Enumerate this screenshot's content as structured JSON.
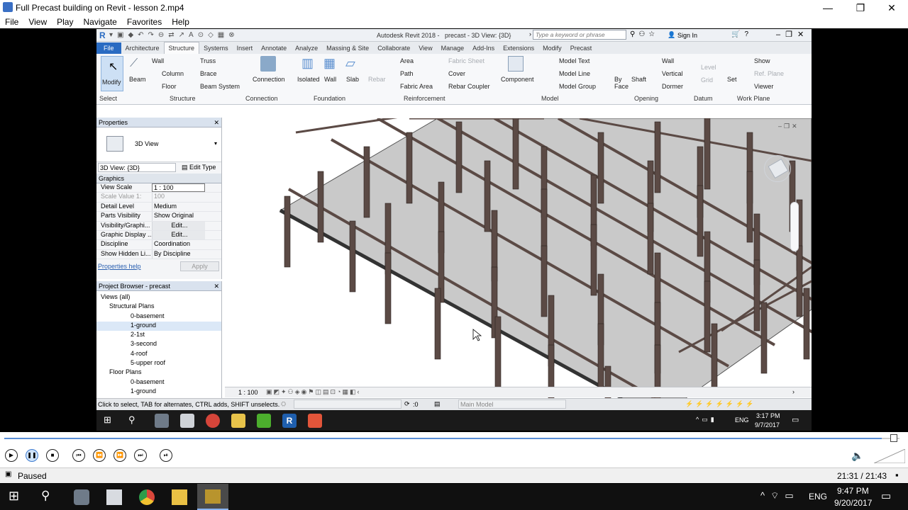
{
  "player": {
    "title": "Full Precast building on Revit - lesson 2.mp4",
    "menu": [
      "File",
      "View",
      "Play",
      "Navigate",
      "Favorites",
      "Help"
    ],
    "status": "Paused",
    "time": "21:31 / 21:43"
  },
  "revit": {
    "app_title": "Autodesk Revit 2018 -",
    "doc_title": "precast - 3D View: {3D}",
    "search_placeholder": "Type a keyword or phrase",
    "sign_in": "Sign In",
    "tabs": [
      "File",
      "Architecture",
      "Structure",
      "Systems",
      "Insert",
      "Annotate",
      "Analyze",
      "Massing & Site",
      "Collaborate",
      "View",
      "Manage",
      "Add-Ins",
      "Extensions",
      "Modify",
      "Precast"
    ],
    "active_tab": "Structure",
    "ribbon": {
      "modify": "Modify",
      "select": "Select",
      "beam": "Beam",
      "wall": "Wall",
      "column": "Column",
      "floor": "Floor",
      "truss": "Truss",
      "brace": "Brace",
      "beam_system": "Beam System",
      "structure": "Structure",
      "connection": "Connection",
      "connection_panel": "Connection",
      "isolated": "Isolated",
      "found_wall": "Wall",
      "slab": "Slab",
      "foundation": "Foundation",
      "rebar": "Rebar",
      "area": "Area",
      "path": "Path",
      "fabric_area": "Fabric Area",
      "fabric_sheet": "Fabric Sheet",
      "cover": "Cover",
      "rebar_coupler": "Rebar Coupler",
      "reinforcement": "Reinforcement",
      "component": "Component",
      "model_text": "Model Text",
      "model_line": "Model Line",
      "model_group": "Model Group",
      "model": "Model",
      "by_face_1": "By",
      "by_face_2": "Face",
      "shaft": "Shaft",
      "op_wall": "Wall",
      "vertical": "Vertical",
      "dormer": "Dormer",
      "opening": "Opening",
      "level": "Level",
      "grid": "Grid",
      "datum": "Datum",
      "set": "Set",
      "show": "Show",
      "ref_plane": "Ref. Plane",
      "viewer": "Viewer",
      "work_plane": "Work Plane"
    },
    "properties": {
      "title": "Properties",
      "type": "3D View",
      "selector": "3D View: {3D}",
      "edit_type": "Edit Type",
      "section": "Graphics",
      "rows": [
        {
          "k": "View Scale",
          "v": "1 : 100"
        },
        {
          "k": "Scale Value   1:",
          "v": "100"
        },
        {
          "k": "Detail Level",
          "v": "Medium"
        },
        {
          "k": "Parts Visibility",
          "v": "Show Original"
        },
        {
          "k": "Visibility/Graphi...",
          "v": "Edit..."
        },
        {
          "k": "Graphic Display ...",
          "v": "Edit..."
        },
        {
          "k": "Discipline",
          "v": "Coordination"
        },
        {
          "k": "Show Hidden Li...",
          "v": "By Discipline"
        }
      ],
      "help": "Properties help",
      "apply": "Apply"
    },
    "browser": {
      "title": "Project Browser - precast",
      "items": [
        "Views (all)",
        "Structural Plans",
        "0-basement",
        "1-ground",
        "2-1st",
        "3-second",
        "4-roof",
        "5-upper roof",
        "Floor Plans",
        "0-basement",
        "1-ground"
      ]
    },
    "view_scale": "1 : 100",
    "status_text": "Click to select, TAB for alternates, CTRL adds, SHIFT unselects.",
    "zero": ":0",
    "main_model": "Main Model",
    "clock_time": "3:17 PM",
    "clock_date": "9/7/2017",
    "lang": "ENG"
  },
  "windows": {
    "lang": "ENG",
    "time": "9:47 PM",
    "date": "9/20/2017"
  },
  "colors": {
    "accent": "#2a6bc2",
    "column": "#5b4a45",
    "slab": "#c9c9c9"
  }
}
